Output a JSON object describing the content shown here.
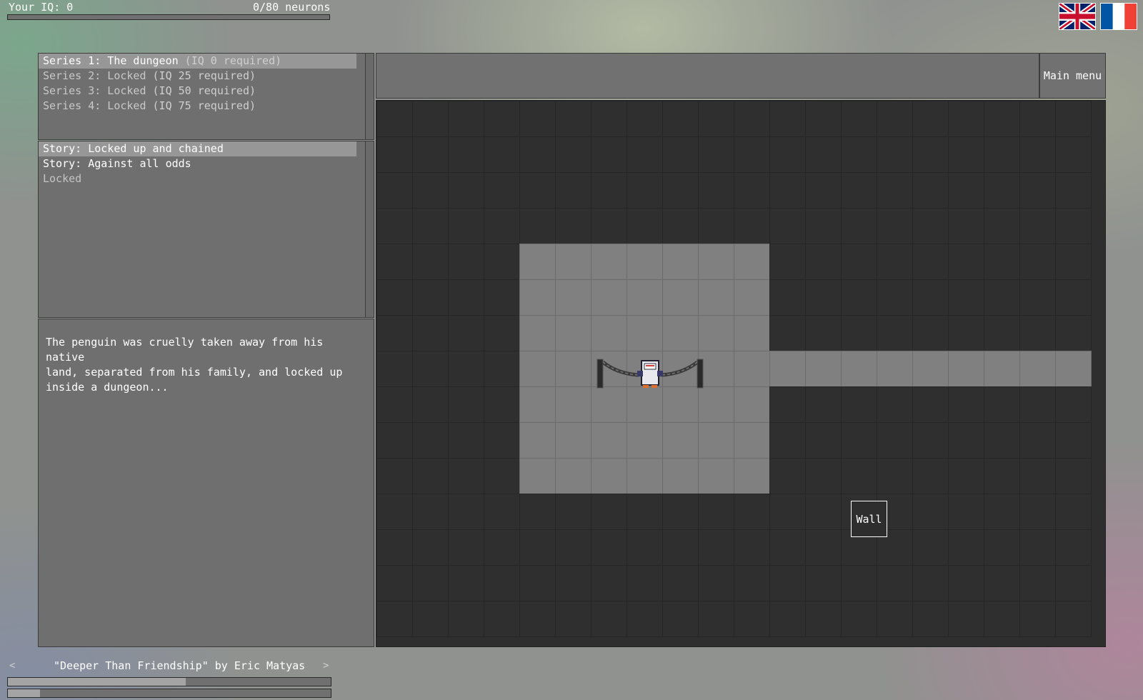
{
  "hud": {
    "iq_label": "Your IQ: 0",
    "neurons_label": "0/80 neurons",
    "neurons_fraction": 0
  },
  "languages": [
    {
      "name": "English",
      "icon": "uk-flag-icon"
    },
    {
      "name": "French",
      "icon": "france-flag-icon"
    }
  ],
  "series": [
    {
      "title": "Series 1: The dungeon",
      "req": "(IQ 0 required)",
      "selected": true
    },
    {
      "title": "Series 2: Locked",
      "req": "(IQ 25 required)",
      "selected": false
    },
    {
      "title": "Series 3: Locked",
      "req": "(IQ 50 required)",
      "selected": false
    },
    {
      "title": "Series 4: Locked",
      "req": "(IQ 75 required)",
      "selected": false
    }
  ],
  "stories": [
    {
      "title": "Story: Locked up and chained",
      "selected": true
    },
    {
      "title": "Story: Against all odds",
      "selected": false
    },
    {
      "title": "Locked",
      "selected": false
    }
  ],
  "description": "The penguin was cruelly taken away from his native\nland, separated from his family, and locked up\ninside a dungeon...",
  "header": {
    "title": "",
    "main_menu_label": "Main menu"
  },
  "tooltip": {
    "label": "Wall"
  },
  "music": {
    "prev": "<",
    "next": ">",
    "title": "\"Deeper Than Friendship\" by Eric Matyas",
    "progress": 0.55,
    "volume": 0.1
  },
  "colors": {
    "floor": "#808080",
    "wall": "#2f2f2f",
    "panel": "#6f6f6f",
    "selected_row": "#979797"
  },
  "level": {
    "cols": 20,
    "rows": 15,
    "floor_rows": [
      ".....................",
      "....................",
      "....................",
      "....................",
      "....#######.........",
      "....#######.........",
      "....#######.........",
      "....################",
      "....#######.........",
      "....#######.........",
      "....#######.........",
      "....................",
      "....................",
      "....................",
      "...................."
    ]
  }
}
